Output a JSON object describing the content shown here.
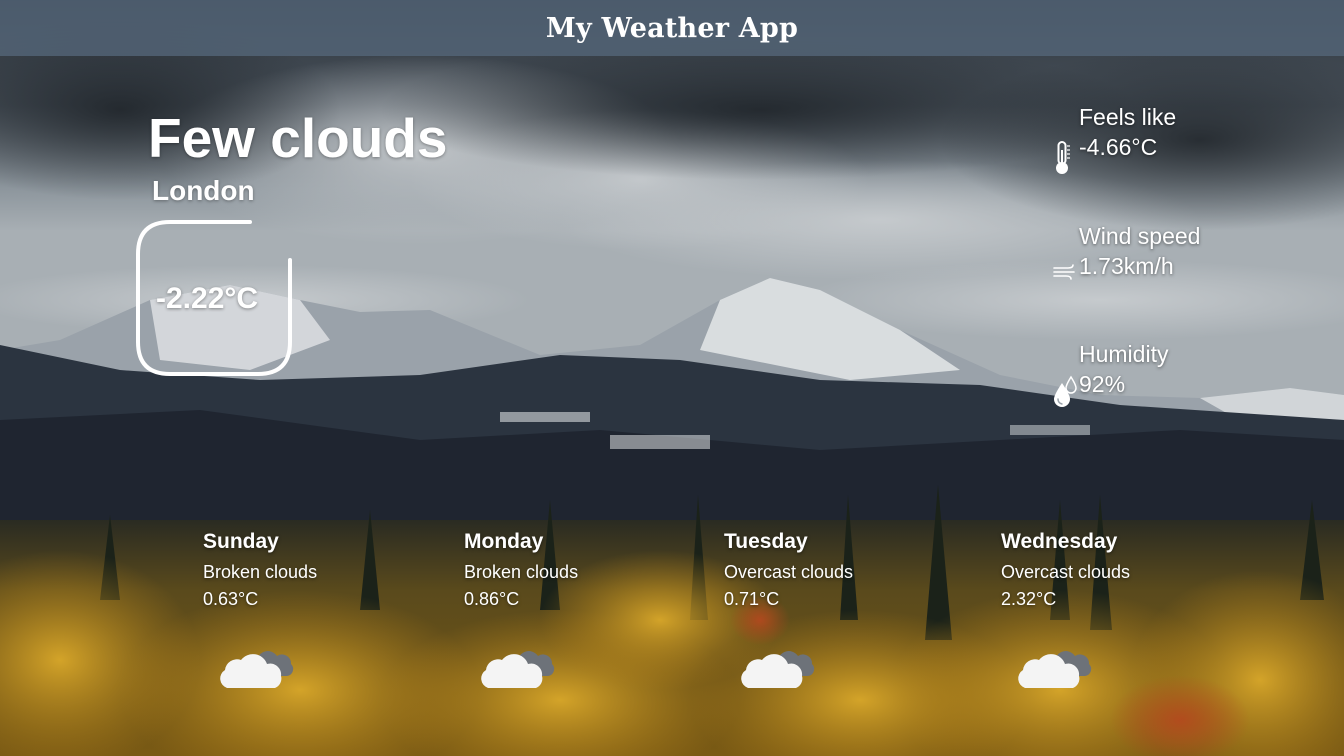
{
  "app": {
    "title": "My Weather App"
  },
  "current": {
    "condition": "Few clouds",
    "city": "London",
    "temperature": "-2.22°C"
  },
  "stats": [
    {
      "label": "Feels like",
      "value": "-4.66°C",
      "icon": "thermometer-icon"
    },
    {
      "label": "Wind speed",
      "value": "1.73km/h",
      "icon": "wind-icon"
    },
    {
      "label": "Humidity",
      "value": "92%",
      "icon": "humidity-icon"
    }
  ],
  "forecast": [
    {
      "day": "Sunday",
      "description": "Broken clouds",
      "temperature": "0.63°C",
      "icon": "cloud-icon"
    },
    {
      "day": "Monday",
      "description": "Broken clouds",
      "temperature": "0.86°C",
      "icon": "cloud-icon"
    },
    {
      "day": "Tuesday",
      "description": "Overcast clouds",
      "temperature": "0.71°C",
      "icon": "cloud-icon"
    },
    {
      "day": "Wednesday",
      "description": "Overcast clouds",
      "temperature": "2.32°C",
      "icon": "cloud-icon"
    }
  ],
  "colors": {
    "header": "#54667a",
    "text": "#ffffff",
    "sky": "#3a4450",
    "foliage": "#b8861f"
  }
}
